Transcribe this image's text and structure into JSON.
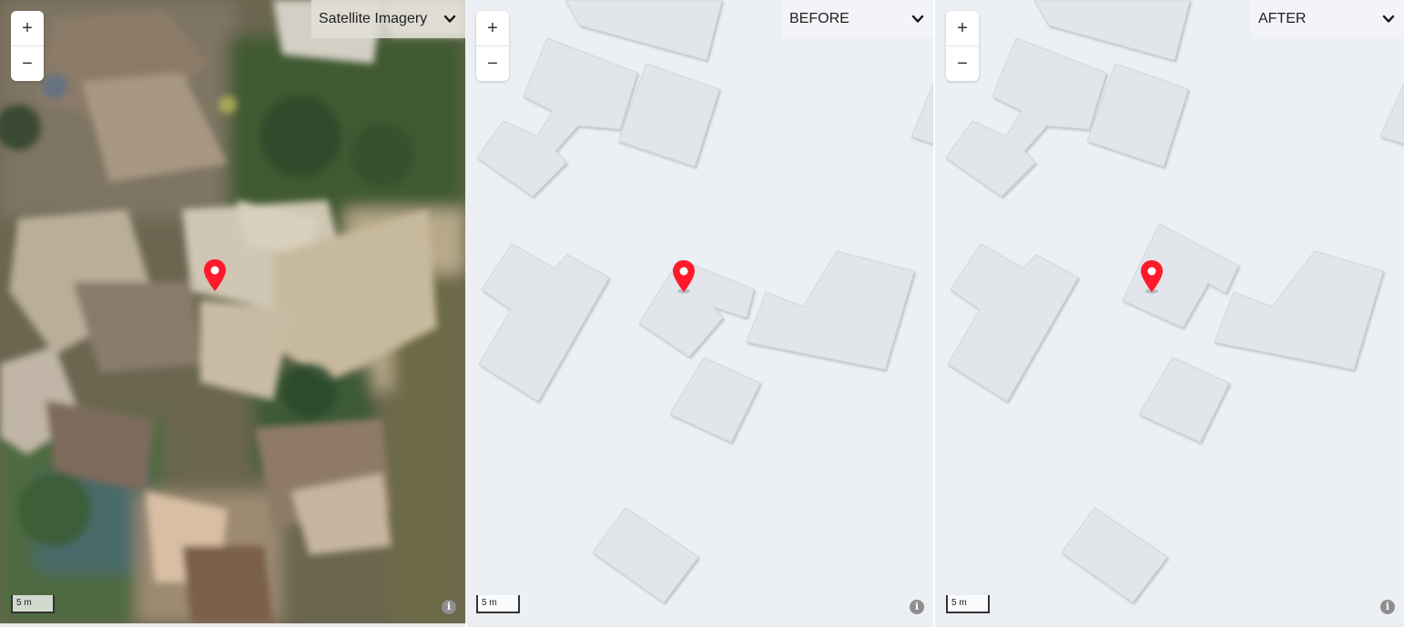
{
  "panels": {
    "satellite": {
      "layer_label": "Satellite Imagery",
      "scale_label": "5 m",
      "info_icon": "info-icon"
    },
    "before": {
      "layer_label": "BEFORE",
      "scale_label": "5 m",
      "info_icon": "info-icon"
    },
    "after": {
      "layer_label": "AFTER",
      "scale_label": "5 m",
      "info_icon": "info-icon"
    }
  },
  "zoom": {
    "in_label": "+",
    "out_label": "−"
  },
  "info_glyph": "i",
  "colors": {
    "pin": "#ff1a2b",
    "building_fill": "#e2e5ea",
    "building_stroke": "#cfd3d9",
    "map_background": "#eceff3"
  },
  "icons": [
    "plus-icon",
    "minus-icon",
    "chevron-down-icon",
    "map-pin-icon",
    "info-icon"
  ]
}
